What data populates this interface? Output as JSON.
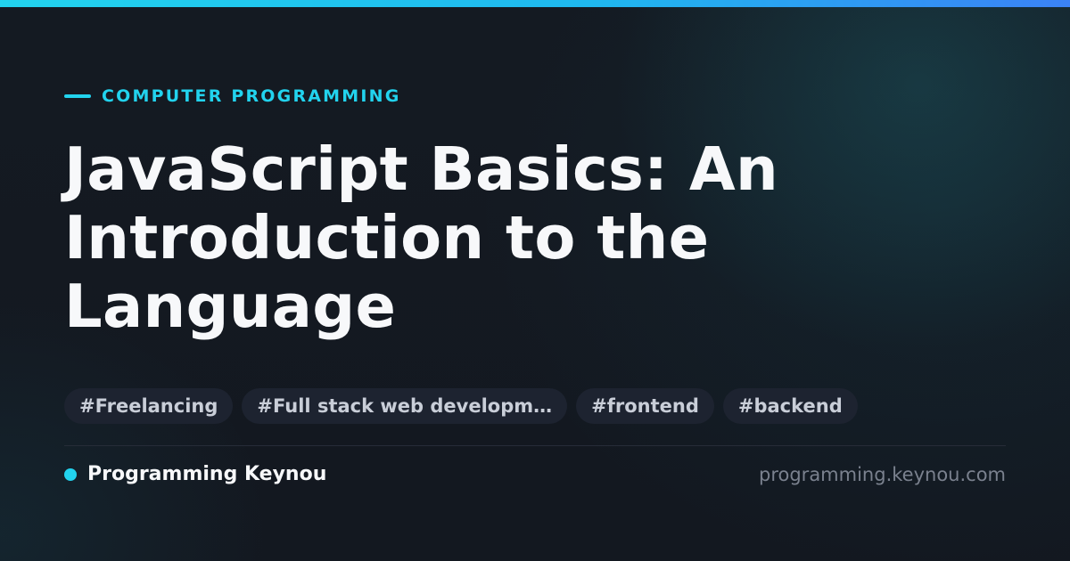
{
  "colors": {
    "accent": "#22d3ee",
    "accent_gradient_end": "#3b82f6",
    "background": "#131820",
    "title": "#f7f8fa",
    "tag_background": "#1d2330",
    "tag_text": "#c9ced8",
    "muted_text": "#7a818e"
  },
  "header": {
    "category": "COMPUTER PROGRAMMING"
  },
  "article": {
    "title": "JavaScript Basics: An Introduction to the Language"
  },
  "tags": [
    "#Freelancing",
    "#Full stack web developm…",
    "#frontend",
    "#backend"
  ],
  "footer": {
    "brand": "Programming Keynou",
    "url": "programming.keynou.com"
  }
}
